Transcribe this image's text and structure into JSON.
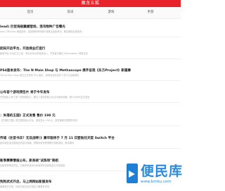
{
  "site": {
    "title": "魔龙五狐"
  },
  "nav": {
    "tabs": [
      "首页",
      "资讯",
      "游戏",
      "手游"
    ]
  },
  "articles": [
    {
      "title": "lead) 巨型海报震撼登场，混沌物种广告曝光",
      "desc": "lead (TNOlive) 网络游戏，混沌物种系列新作将推出全新资讯，敬请期待后续更多..."
    },
    {
      "title": "起码开启平台，开放商业打造行",
      "desc": "起码开启 平台正式上线，商业合作伙伴陆续加入，开发者可通过 Steamworks 获取支持"
    },
    {
      "title": "PS4版本发布：The N Main Shop 与 Methascope 携手呈现《东方Project》新篇章",
      "desc": "The N Main Shop 现已正式发布 PS4 版本，游戏内容包含多个关卡与全新角色"
    },
    {
      "title": "公布首个游戏预告片 将于今年发布",
      "desc": "开发团队公布了首个游戏预告片，展示了游戏的核心玩法与美术风格，预计今年内正式发售"
    },
    {
      "title": "：失落的王国》正式发售 售价 198 元",
      "desc": "《失落的王国》现已登陆各大平台，游戏售价 198 元，首发期间享受限时折扣"
    },
    {
      "title": "传城（往昔书兵？无双战神）》豪华版将于 7 月 11 日登陆任天堂 Switch 平台",
      "desc": "豪华版包含全部追加内容与特典，预购玩家可获得额外奖励道具，敬请期待"
    },
    {
      "title": "新季赛事情报公布，新系统\"试炼场\"亮相",
      "desc": "全新赛季即将开启，试炼场系统将为玩家带来全新挑战与丰厚奖励"
    },
    {
      "title": "狗狗武式开启，马上网网站新服发布",
      "desc": "新服现已开放，玩家可前往官方网站了解更多详情"
    }
  ],
  "watermark": {
    "big": "便民库",
    "small": "www.bmku.com"
  },
  "colors": {
    "brand": "#e8232b",
    "watermark": "#2a8be0"
  }
}
